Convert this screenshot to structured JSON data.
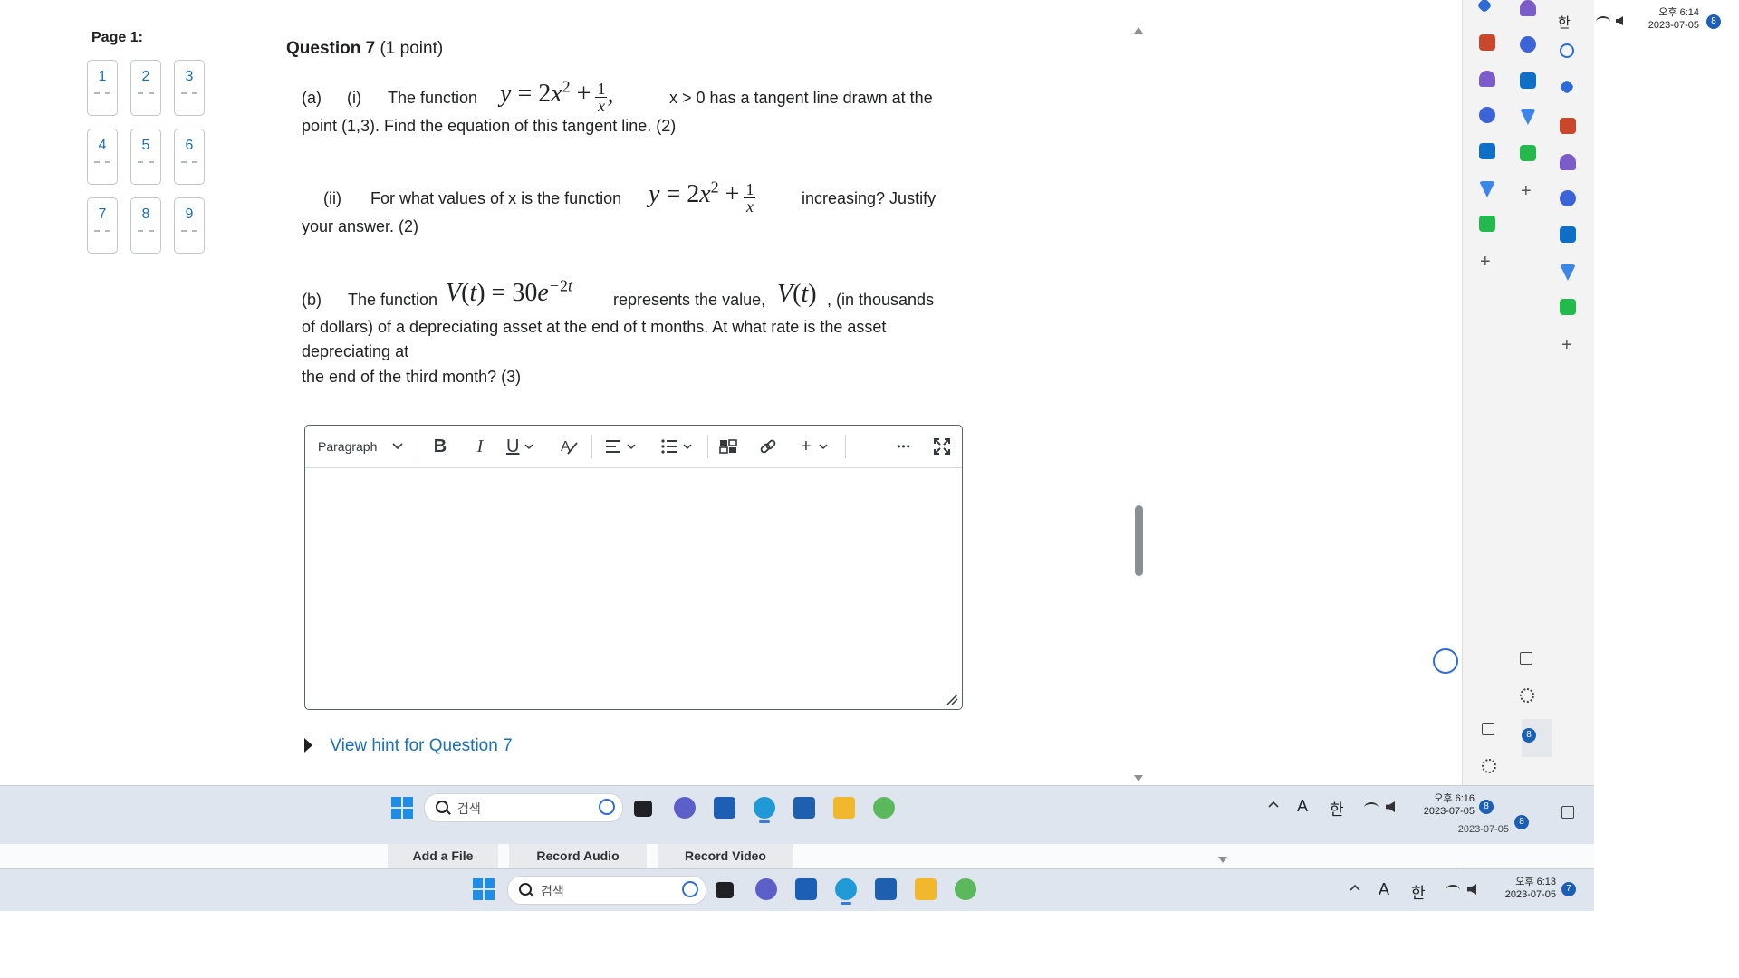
{
  "nav": {
    "page_label": "Page 1:",
    "questions": [
      "1",
      "2",
      "3",
      "4",
      "5",
      "6",
      "7",
      "8",
      "9"
    ]
  },
  "question": {
    "title": "Question 7",
    "points": "(1 point)",
    "a_i_label": "(a)",
    "a_i_sub": "(i)",
    "a_i_text1": "The function",
    "a_i_text2": "x > 0 has a tangent line drawn at the",
    "a_i_text3": "point (1,3). Find the equation of this tangent line.   (2)",
    "a_ii_sub": "(ii)",
    "a_ii_text1": "For what values of x is the function",
    "a_ii_text2": "increasing? Justify",
    "a_ii_text3": "your answer.    (2)",
    "b_label": "(b)",
    "b_text1": "The function",
    "b_text2": "represents the value,",
    "b_text3": ", (in thousands",
    "b_text4": "of dollars) of a depreciating asset at the end of t months. At what rate is the asset",
    "b_text5": "depreciating at",
    "b_text6": "the end of the third month?    (3)"
  },
  "editor": {
    "paragraph_label": "Paragraph",
    "bold": "B",
    "italic": "I",
    "underline": "U",
    "plus": "+",
    "more": "•••"
  },
  "hint": {
    "label": "View hint for Question 7"
  },
  "media": {
    "add_file": "Add a File",
    "record_audio": "Record Audio",
    "record_video": "Record Video"
  },
  "taskbar_main": {
    "search_placeholder": "검색",
    "ime_a": "A",
    "ime_han": "한",
    "time": "오후 6:16",
    "date": "2023-07-05",
    "badge": "8"
  },
  "taskbar_bottom": {
    "search_placeholder": "검색",
    "ime_a": "A",
    "ime_han": "한",
    "time": "오후 6:13",
    "date": "2023-07-05",
    "badge": "7"
  },
  "taskbar_ghost": {
    "date": "2023-07-05",
    "badge": "8"
  },
  "tray_top": {
    "ime_han": "한",
    "time": "오후 6:14",
    "date": "2023-07-05",
    "badge": "8"
  },
  "sidebar": {
    "badge": "8",
    "plus": "+"
  },
  "colors": {
    "link": "#1a6fb5",
    "taskbar": "#dee5ee",
    "sidebar": "#f3f3f3",
    "badge": "#1a5fb4"
  }
}
